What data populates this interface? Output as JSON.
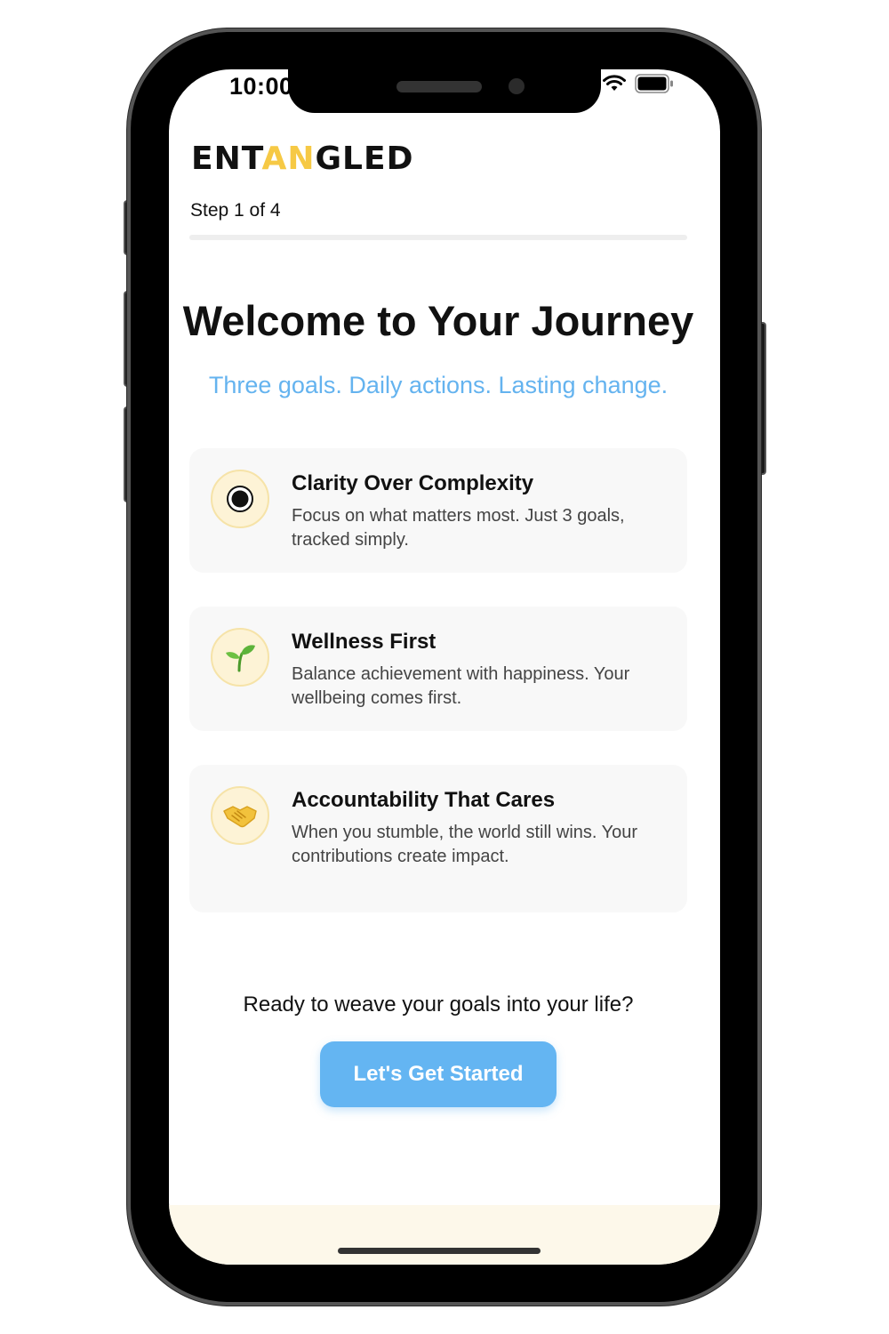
{
  "status_bar": {
    "time": "10:00",
    "icons": [
      "wifi-icon",
      "battery-icon"
    ]
  },
  "header": {
    "logo_prefix": "ENT",
    "logo_accent": "AN",
    "logo_suffix": "GLED",
    "step_label": "Step 1 of 4",
    "progress_percent": 0
  },
  "main": {
    "title": "Welcome to Your Journey",
    "subtitle": "Three goals. Daily actions. Lasting change.",
    "cards": [
      {
        "icon": "target-icon",
        "title": "Clarity Over Complexity",
        "description": "Focus on what matters most. Just 3 goals, tracked simply."
      },
      {
        "icon": "seedling-icon",
        "title": "Wellness First",
        "description": "Balance achievement with happiness. Your wellbeing comes first."
      },
      {
        "icon": "handshake-icon",
        "title": "Accountability That Cares",
        "description": "When you stumble, the world still wins. Your contributions create impact."
      }
    ],
    "cta_text": "Ready to weave your goals into your life?",
    "cta_button": "Let's Get Started"
  },
  "colors": {
    "accent_yellow": "#f6c945",
    "primary_blue": "#64b5f2",
    "subtitle_blue": "#64b3ef",
    "card_bg": "#f8f8f8",
    "icon_bg": "#fdf3d6"
  }
}
